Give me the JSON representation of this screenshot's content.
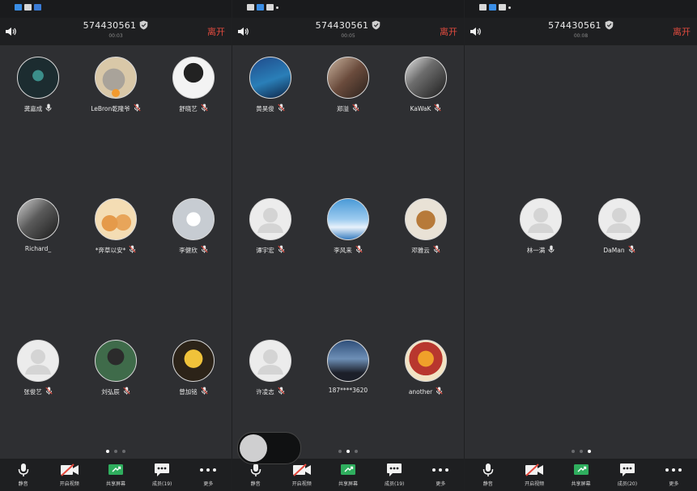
{
  "colors": {
    "leave": "#e14b3f",
    "share_green": "#2fae5e",
    "video_red": "#e5483c"
  },
  "panels": [
    {
      "meeting_id": "574430561",
      "timer": "00:03",
      "leave": "离开",
      "status_icons": [
        "weather-icon",
        "chat-icon",
        "app-icon"
      ],
      "participants": [
        {
          "name": "龚嘉成",
          "mic": "on",
          "avatar": "teal-figure"
        },
        {
          "name": "LeBron乾隆爷",
          "mic": "muted",
          "avatar": "cartoon-cat",
          "host_badge": true
        },
        {
          "name": "舒晓艺",
          "mic": "muted",
          "avatar": "anime-man"
        },
        {
          "name": "Richard_",
          "mic": "none",
          "avatar": "dark-photo"
        },
        {
          "name": "*奔草以安*",
          "mic": "muted",
          "avatar": "kittens"
        },
        {
          "name": "李健欣",
          "mic": "muted",
          "avatar": "astronaut"
        },
        {
          "name": "张俊艺",
          "mic": "muted",
          "avatar": "default"
        },
        {
          "name": "刘弘辰",
          "mic": "muted",
          "avatar": "portrait-woman"
        },
        {
          "name": "曾加铭",
          "mic": "muted",
          "avatar": "cartoon-glasses"
        }
      ],
      "page_dots": 3,
      "active_dot": 0,
      "toolbar": [
        {
          "icon": "mic-icon",
          "label": "静音"
        },
        {
          "icon": "video-off-icon",
          "label": "开启视频"
        },
        {
          "icon": "share-screen-icon",
          "label": "共享屏幕"
        },
        {
          "icon": "members-icon",
          "label": "成员(19)"
        },
        {
          "icon": "more-icon",
          "label": "更多"
        }
      ]
    },
    {
      "meeting_id": "574430561",
      "timer": "00:05",
      "leave": "离开",
      "status_icons": [
        "image-icon",
        "weather-icon",
        "chat-icon",
        "dot-icon"
      ],
      "participants": [
        {
          "name": "黄昊俊",
          "mic": "muted",
          "avatar": "blue-night"
        },
        {
          "name": "郑溢",
          "mic": "muted",
          "avatar": "two-people"
        },
        {
          "name": "KaWaK",
          "mic": "muted",
          "avatar": "bw-city"
        },
        {
          "name": "谭宇宏",
          "mic": "muted",
          "avatar": "default"
        },
        {
          "name": "李风来",
          "mic": "muted",
          "avatar": "sky-clouds"
        },
        {
          "name": "邓雅云",
          "mic": "muted",
          "avatar": "teddy-bear"
        },
        {
          "name": "许凌志",
          "mic": "muted",
          "avatar": "default"
        },
        {
          "name": "187****3620",
          "mic": "none",
          "avatar": "dusk-sky"
        },
        {
          "name": "another",
          "mic": "muted",
          "avatar": "poster"
        }
      ],
      "page_dots": 3,
      "active_dot": 1,
      "toolbar": [
        {
          "icon": "mic-icon",
          "label": "静音"
        },
        {
          "icon": "video-off-icon",
          "label": "开启视频"
        },
        {
          "icon": "share-screen-icon",
          "label": "共享屏幕"
        },
        {
          "icon": "members-icon",
          "label": "成员(19)"
        },
        {
          "icon": "more-icon",
          "label": "更多"
        }
      ]
    },
    {
      "meeting_id": "574430561",
      "timer": "00:08",
      "leave": "离开",
      "status_icons": [
        "image-icon",
        "weather-icon",
        "chat-icon",
        "dot-icon"
      ],
      "participants": [
        {
          "name": "林一满",
          "mic": "on",
          "avatar": "default"
        },
        {
          "name": "DaMan",
          "mic": "muted",
          "avatar": "default"
        }
      ],
      "page_dots": 3,
      "active_dot": 2,
      "toolbar": [
        {
          "icon": "mic-icon",
          "label": "静音"
        },
        {
          "icon": "video-off-icon",
          "label": "开启视频"
        },
        {
          "icon": "share-screen-icon",
          "label": "共享屏幕"
        },
        {
          "icon": "members-icon",
          "label": "成员(20)"
        },
        {
          "icon": "more-icon",
          "label": "更多"
        }
      ]
    }
  ]
}
